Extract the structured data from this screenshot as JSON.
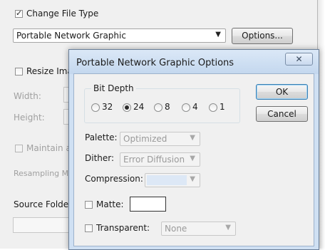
{
  "background_window": {
    "change_file_type": {
      "label": "Change File Type",
      "checked": true
    },
    "file_type_select": {
      "value": "Portable Network Graphic"
    },
    "options_button": "Options...",
    "resize_images": {
      "label": "Resize Ima",
      "checked": false
    },
    "width_label": "Width:",
    "height_label": "Height:",
    "maintain_aspect": {
      "label": "Maintain a",
      "checked": false
    },
    "resampling_label": "Resampling M",
    "source_folder_label": "Source Folder"
  },
  "dialog": {
    "title": "Portable Network Graphic Options",
    "close_glyph": "✕",
    "bit_depth": {
      "label": "Bit Depth",
      "options": [
        "32",
        "24",
        "8",
        "4",
        "1"
      ],
      "selected": "24"
    },
    "ok_button": "OK",
    "cancel_button": "Cancel",
    "palette": {
      "label": "Palette:",
      "value": "Optimized",
      "enabled": false
    },
    "dither": {
      "label": "Dither:",
      "value": "Error Diffusion",
      "enabled": false
    },
    "compression": {
      "label": "Compression:",
      "value": "",
      "enabled": false
    },
    "matte": {
      "label": "Matte:",
      "checked": false,
      "color": "#ffffff"
    },
    "transparent": {
      "label": "Transparent:",
      "checked": false,
      "value": "None",
      "enabled": false
    }
  }
}
